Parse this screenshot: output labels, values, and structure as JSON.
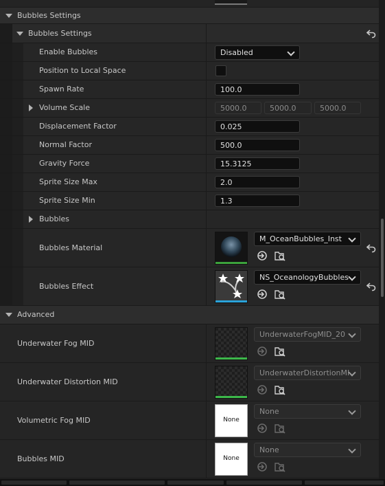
{
  "sections": {
    "bubbles_settings": {
      "label": "Bubbles Settings"
    },
    "bubbles_settings_inner": {
      "label": "Bubbles Settings"
    },
    "advanced": {
      "label": "Advanced"
    }
  },
  "props": {
    "enable_bubbles": {
      "label": "Enable Bubbles",
      "value": "Disabled"
    },
    "position_local": {
      "label": "Position to Local Space",
      "checked": false
    },
    "spawn_rate": {
      "label": "Spawn Rate",
      "value": "100.0"
    },
    "volume_scale": {
      "label": "Volume Scale",
      "x": "5000.0",
      "y": "5000.0",
      "z": "5000.0"
    },
    "displacement": {
      "label": "Displacement Factor",
      "value": "0.025"
    },
    "normal_factor": {
      "label": "Normal Factor",
      "value": "500.0"
    },
    "gravity": {
      "label": "Gravity Force",
      "value": "15.3125"
    },
    "sprite_max": {
      "label": "Sprite Size Max",
      "value": "2.0"
    },
    "sprite_min": {
      "label": "Sprite Size Min",
      "value": "1.3"
    },
    "bubbles": {
      "label": "Bubbles"
    },
    "bubbles_material": {
      "label": "Bubbles Material",
      "asset": "M_OceanBubbles_Inst"
    },
    "bubbles_effect": {
      "label": "Bubbles Effect",
      "asset": "NS_OceanologyBubbles"
    },
    "fog_mid": {
      "label": "Underwater Fog MID",
      "asset": "UnderwaterFogMID_20"
    },
    "distortion_mid": {
      "label": "Underwater Distortion MID",
      "asset": "UnderwaterDistortionMI"
    },
    "volumetric_mid": {
      "label": "Volumetric Fog MID",
      "asset": "None",
      "thumb": "None"
    },
    "bubbles_mid": {
      "label": "Bubbles MID",
      "asset": "None",
      "thumb": "None"
    }
  },
  "icons": {
    "reset": "reset-to-default-icon",
    "use": "use-selected-asset-icon",
    "browse": "browse-to-asset-icon"
  },
  "colors": {
    "material_bar": "#3ca33c",
    "effect_bar": "#2aa3d9",
    "texture_bar": "#3cb84a",
    "none_bar": "#ffffff"
  }
}
